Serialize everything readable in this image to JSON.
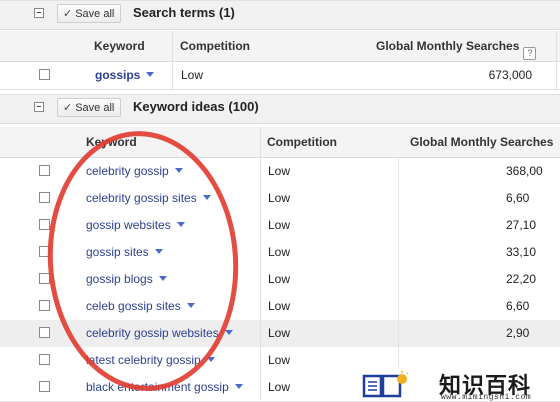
{
  "search_terms": {
    "title": "Search terms (1)",
    "save_all": "Save all",
    "columns": {
      "keyword": "Keyword",
      "competition": "Competition",
      "searches": "Global Monthly Searches"
    },
    "rows": [
      {
        "keyword": "gossips",
        "competition": "Low",
        "searches": "673,000"
      }
    ]
  },
  "keyword_ideas": {
    "title": "Keyword ideas (100)",
    "save_all": "Save all",
    "columns": {
      "keyword": "Keyword",
      "competition": "Competition",
      "searches": "Global Monthly Searches"
    },
    "rows": [
      {
        "keyword": "celebrity gossip",
        "competition": "Low",
        "searches": "368,00"
      },
      {
        "keyword": "celebrity gossip sites",
        "competition": "Low",
        "searches": "6,60"
      },
      {
        "keyword": "gossip websites",
        "competition": "Low",
        "searches": "27,10"
      },
      {
        "keyword": "gossip sites",
        "competition": "Low",
        "searches": "33,10"
      },
      {
        "keyword": "gossip blogs",
        "competition": "Low",
        "searches": "22,20"
      },
      {
        "keyword": "celeb gossip sites",
        "competition": "Low",
        "searches": "6,60"
      },
      {
        "keyword": "celebrity gossip websites",
        "competition": "Low",
        "searches": "2,90"
      },
      {
        "keyword": "latest celebrity gossip",
        "competition": "Low",
        "searches": ""
      },
      {
        "keyword": "black entertainment gossip",
        "competition": "Low",
        "searches": ""
      }
    ]
  },
  "watermark": {
    "name": "知识百科",
    "url": "www.mimingshi.com"
  },
  "colors": {
    "keyword_link": "#2c3f93",
    "annotation_ring": "#e03a2e",
    "header_bg": "#f1f1f1"
  },
  "icons": [
    "collapse-icon",
    "checkmark-icon",
    "help-icon",
    "dropdown-caret-icon",
    "checkbox"
  ]
}
